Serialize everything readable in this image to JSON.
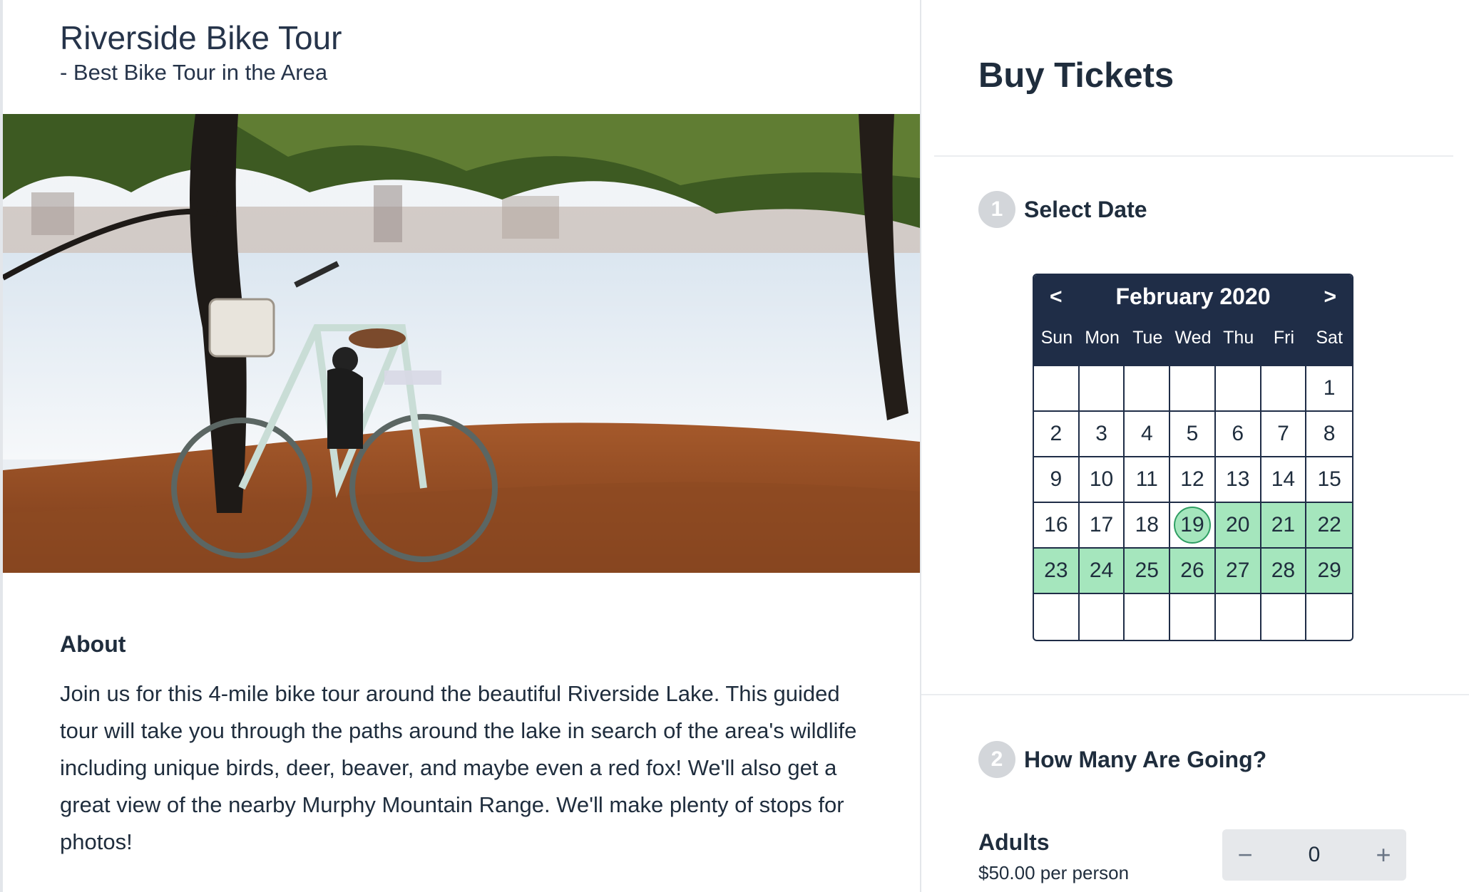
{
  "header": {
    "title": "Riverside Bike Tour",
    "subtitle": "- Best Bike Tour in the Area"
  },
  "hero_image": {
    "subject": "bicycle-by-lake"
  },
  "about": {
    "heading": "About",
    "text": "Join us for this 4-mile bike tour around the beautiful Riverside Lake. This guided tour will take you through the paths around the lake in search of the area's wildlife including unique birds, deer, beaver, and maybe even a red fox! We'll also get a great view of the nearby Murphy Mountain Range. We'll make plenty of stops for photos!"
  },
  "purchase": {
    "title": "Buy Tickets",
    "steps": [
      {
        "number": "1",
        "title": "Select Date"
      },
      {
        "number": "2",
        "title": "How Many Are Going?"
      }
    ]
  },
  "calendar": {
    "month_label": "February 2020",
    "prev_label": "<",
    "next_label": ">",
    "weekdays": [
      "Sun",
      "Mon",
      "Tue",
      "Wed",
      "Thu",
      "Fri",
      "Sat"
    ],
    "cells": [
      "",
      "",
      "",
      "",
      "",
      "",
      "1",
      "2",
      "3",
      "4",
      "5",
      "6",
      "7",
      "8",
      "9",
      "10",
      "11",
      "12",
      "13",
      "14",
      "15",
      "16",
      "17",
      "18",
      "19",
      "20",
      "21",
      "22",
      "23",
      "24",
      "25",
      "26",
      "27",
      "28",
      "29",
      "",
      "",
      "",
      "",
      "",
      "",
      ""
    ],
    "available_days": [
      "19",
      "20",
      "21",
      "22",
      "23",
      "24",
      "25",
      "26",
      "27",
      "28",
      "29"
    ],
    "selected_day": "19",
    "colors": {
      "header": "#1f2d47",
      "available": "#a5e6bd",
      "selected_border": "#2f9e63"
    }
  },
  "tickets": {
    "adults": {
      "label": "Adults",
      "price": "$50.00 per person",
      "quantity": "0",
      "minus_label": "−",
      "plus_label": "+"
    }
  }
}
